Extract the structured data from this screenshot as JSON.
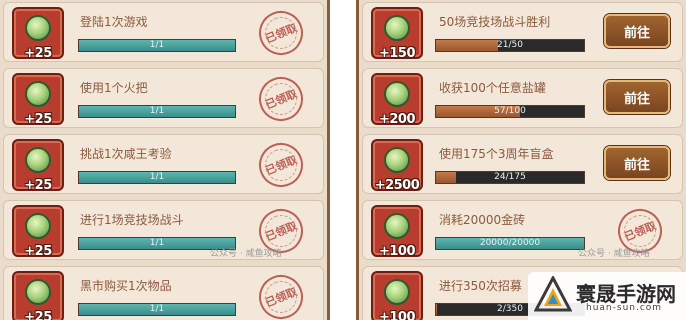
{
  "left_tasks": [
    {
      "title": "登陆1次游戏",
      "progress": "1/1",
      "reward": "+25",
      "status": "已领取",
      "ratio": 1
    },
    {
      "title": "使用1个火把",
      "progress": "1/1",
      "reward": "+25",
      "status": "已领取",
      "ratio": 1
    },
    {
      "title": "挑战1次咸王考验",
      "progress": "1/1",
      "reward": "+25",
      "status": "已领取",
      "ratio": 1
    },
    {
      "title": "进行1场竞技场战斗",
      "progress": "1/1",
      "reward": "+25",
      "status": "已领取",
      "ratio": 1
    },
    {
      "title": "黑市购买1次物品",
      "progress": "1/1",
      "reward": "+25",
      "status": "已领取",
      "ratio": 1
    }
  ],
  "right_tasks": [
    {
      "title": "50场竞技场战斗胜利",
      "progress": "21/50",
      "reward": "+150",
      "button": "前往",
      "ratio": 0.42
    },
    {
      "title": "收获100个任意盐罐",
      "progress": "57/100",
      "reward": "+200",
      "button": "前往",
      "ratio": 0.57
    },
    {
      "title": "使用175个3周年盲盒",
      "progress": "24/175",
      "reward": "+2500",
      "button": "前往",
      "ratio": 0.137
    },
    {
      "title": "消耗20000金砖",
      "progress": "20000/20000",
      "reward": "+100",
      "status": "已领取",
      "ratio": 1
    },
    {
      "title": "进行350次招募",
      "progress": "2/350",
      "reward": "+100",
      "ratio": 0.006
    }
  ],
  "watermark": {
    "left": "公众号 · 咸鱼攻略",
    "right": "公众号 · 咸鱼攻略"
  },
  "site": {
    "name": "寰晟手游网",
    "domain": "huan-sun.com"
  }
}
